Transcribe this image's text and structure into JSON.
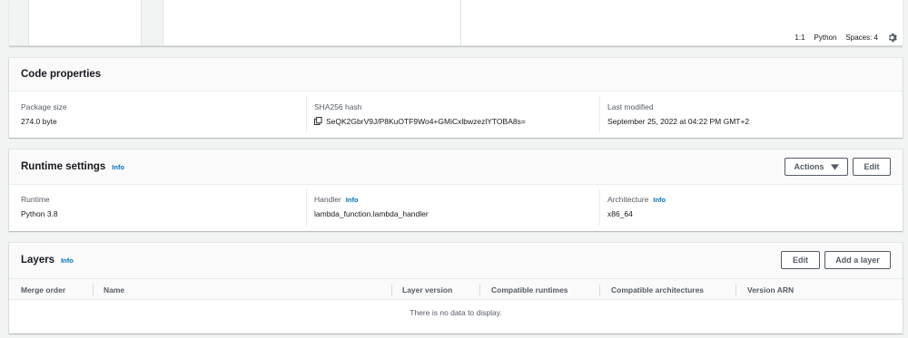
{
  "editor": {
    "status": {
      "position": "1:1",
      "language": "Python",
      "spaces": "Spaces: 4"
    }
  },
  "code_properties": {
    "title": "Code properties",
    "package_size_label": "Package size",
    "package_size_value": "274.0 byte",
    "sha_label": "SHA256 hash",
    "sha_value": "SeQK2GbrV9J/P8KuOTF9Wo4+GMiCxlbwzezlYTOBA8s=",
    "last_modified_label": "Last modified",
    "last_modified_value": "September 25, 2022 at 04:22 PM GMT+2"
  },
  "runtime_settings": {
    "title": "Runtime settings",
    "info": "Info",
    "actions_label": "Actions",
    "edit_label": "Edit",
    "runtime_label": "Runtime",
    "runtime_value": "Python 3.8",
    "handler_label": "Handler",
    "handler_info": "Info",
    "handler_value": "lambda_function.lambda_handler",
    "architecture_label": "Architecture",
    "architecture_info": "Info",
    "architecture_value": "x86_64"
  },
  "layers": {
    "title": "Layers",
    "info": "Info",
    "edit_label": "Edit",
    "add_label": "Add a layer",
    "columns": [
      "Merge order",
      "Name",
      "Layer version",
      "Compatible runtimes",
      "Compatible architectures",
      "Version ARN"
    ],
    "empty_text": "There is no data to display."
  },
  "colors": {
    "link": "#0073bb",
    "text": "#16191f",
    "muted": "#545b64",
    "background": "#f2f3f3"
  },
  "icons": [
    "gear-icon",
    "copy-icon",
    "caret-down-icon"
  ]
}
